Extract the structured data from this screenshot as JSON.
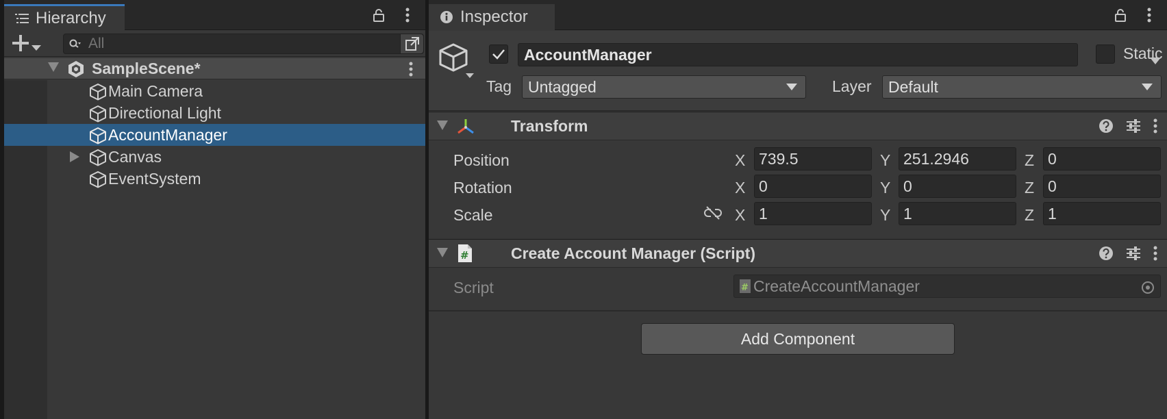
{
  "hierarchy": {
    "tab_label": "Hierarchy",
    "search_placeholder": "All",
    "scene": {
      "name": "SampleScene*"
    },
    "items": [
      {
        "label": "Main Camera",
        "selected": false,
        "has_children": false
      },
      {
        "label": "Directional Light",
        "selected": false,
        "has_children": false
      },
      {
        "label": "AccountManager",
        "selected": true,
        "has_children": false
      },
      {
        "label": "Canvas",
        "selected": false,
        "has_children": true
      },
      {
        "label": "EventSystem",
        "selected": false,
        "has_children": false
      }
    ]
  },
  "inspector": {
    "tab_label": "Inspector",
    "object_name": "AccountManager",
    "active": true,
    "static_label": "Static",
    "static_checked": false,
    "tag_label": "Tag",
    "tag_value": "Untagged",
    "layer_label": "Layer",
    "layer_value": "Default",
    "transform": {
      "title": "Transform",
      "position_label": "Position",
      "rotation_label": "Rotation",
      "scale_label": "Scale",
      "axis_x": "X",
      "axis_y": "Y",
      "axis_z": "Z",
      "position": {
        "x": "739.5",
        "y": "251.2946",
        "z": "0"
      },
      "rotation": {
        "x": "0",
        "y": "0",
        "z": "0"
      },
      "scale": {
        "x": "1",
        "y": "1",
        "z": "1"
      }
    },
    "script_component": {
      "title": "Create Account Manager (Script)",
      "script_label": "Script",
      "script_value": "CreateAccountManager"
    },
    "add_component_label": "Add Component"
  },
  "colors": {
    "selection": "#2c5d87",
    "panel": "#383838",
    "accent_tab": "#3a79bb"
  }
}
